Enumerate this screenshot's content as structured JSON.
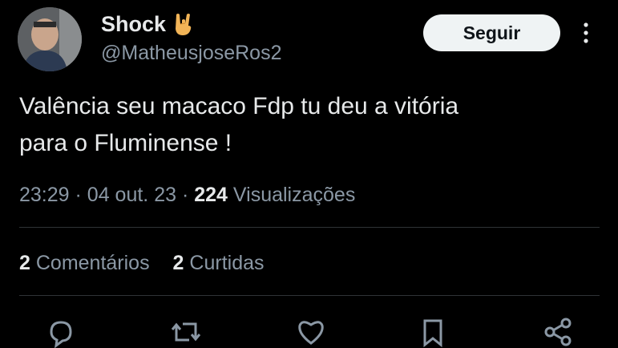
{
  "author": {
    "display_name": "Shock",
    "handle": "@MatheusjoseRos2",
    "name_emoji": "rock-hand-emoji"
  },
  "follow_label": "Seguir",
  "tweet": {
    "text_line_1": "Valência seu macaco Fdp tu deu a vitória",
    "text_line_2": "para o Fluminense !"
  },
  "meta": {
    "time": "23:29",
    "date": "04 out. 23",
    "views_count": "224",
    "views_label": "Visualizações"
  },
  "stats": {
    "comments_count": "2",
    "comments_label": "Comentários",
    "likes_count": "2",
    "likes_label": "Curtidas"
  },
  "actions": [
    "reply-icon",
    "retweet-icon",
    "heart-icon",
    "bookmark-icon",
    "share-icon"
  ],
  "colors": {
    "background": "#000000",
    "primary_text": "#e7e9ea",
    "secondary_text": "#8b98a5",
    "button_bg": "#eff3f4",
    "divider": "#2f3336"
  }
}
